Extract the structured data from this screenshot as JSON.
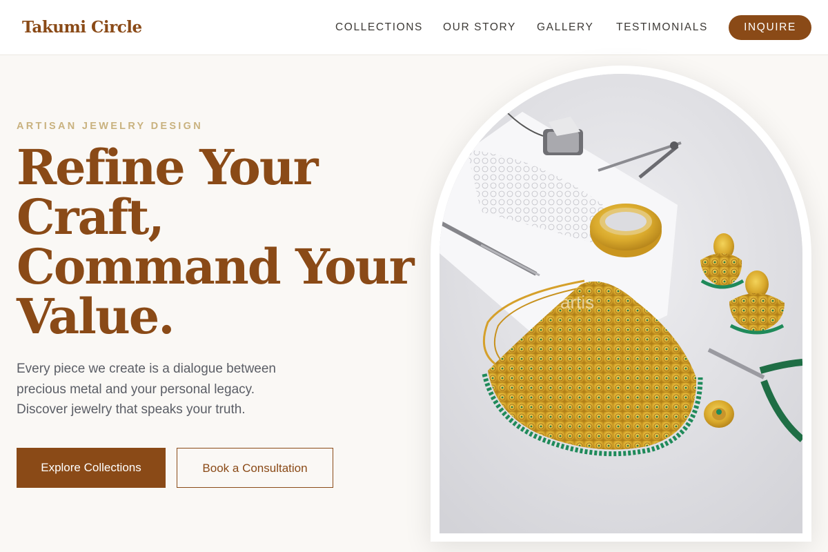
{
  "brand": {
    "name": "Takumi Circle"
  },
  "nav": {
    "items": [
      {
        "label": "COLLECTIONS"
      },
      {
        "label": "OUR STORY"
      },
      {
        "label": "GALLERY"
      },
      {
        "label": "TESTIMONIALS"
      }
    ],
    "cta_label": "INQUIRE"
  },
  "hero": {
    "eyebrow": "ARTISAN JEWELRY DESIGN",
    "title_lines": [
      "Refine Your",
      "Craft,",
      "Command Your",
      "Value."
    ],
    "description_lines": [
      "Every piece we create is a dialogue between",
      "precious metal and your personal legacy.",
      "Discover jewelry that speaks your truth."
    ],
    "primary_button": "Explore Collections",
    "secondary_button": "Book a Consultation",
    "image_watermark": "artis"
  },
  "colors": {
    "brand": "#8a4a17",
    "eyebrow": "#c9b27f",
    "body_text": "#5b5e66",
    "background": "#faf8f5",
    "gold": "#d4a72c",
    "emerald": "#1f8a5a"
  }
}
